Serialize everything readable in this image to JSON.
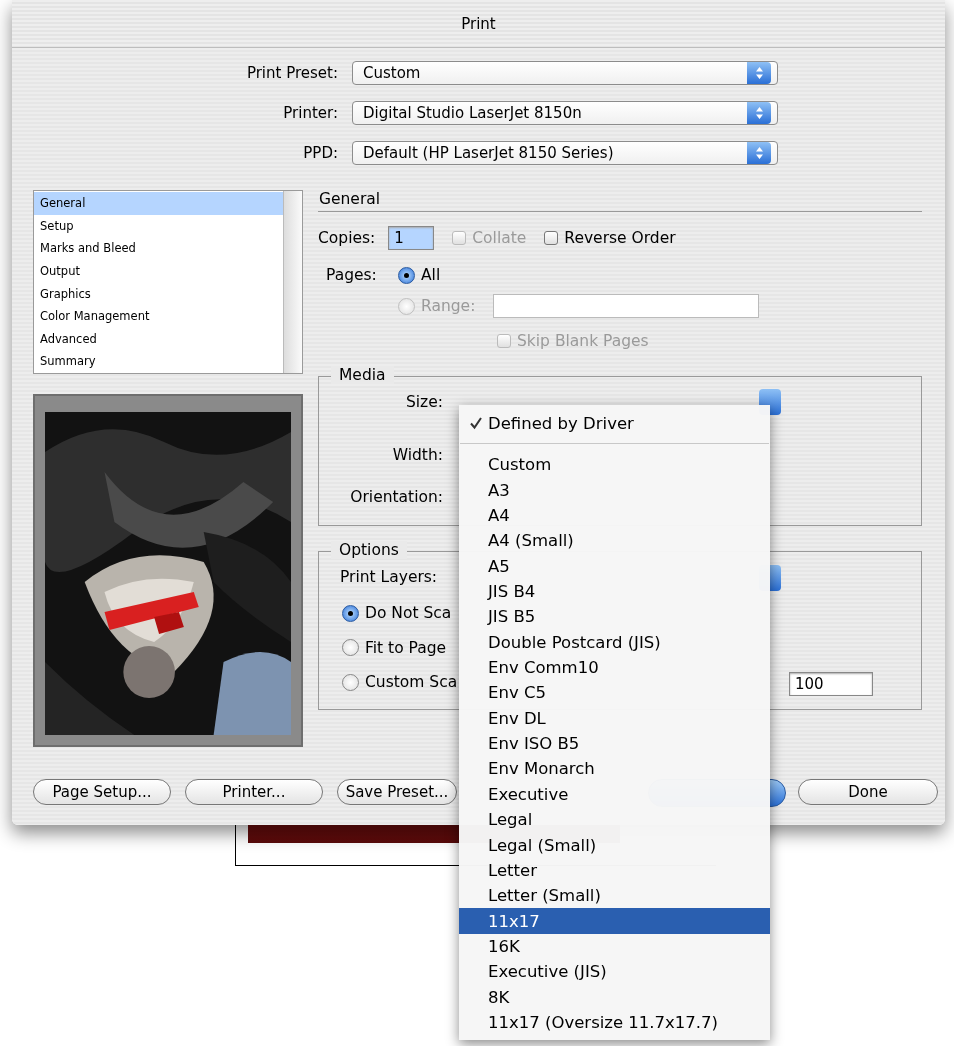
{
  "window": {
    "title": "Print"
  },
  "presets": [
    {
      "label": "Print Preset:",
      "value": "Custom"
    },
    {
      "label": "Printer:",
      "value": "Digital Studio LaserJet 8150n"
    },
    {
      "label": "PPD:",
      "value": "Default (HP LaserJet 8150 Series)"
    }
  ],
  "sidebar": {
    "items": [
      {
        "label": "General",
        "selected": true
      },
      {
        "label": "Setup",
        "selected": false
      },
      {
        "label": "Marks and Bleed",
        "selected": false
      },
      {
        "label": "Output",
        "selected": false
      },
      {
        "label": "Graphics",
        "selected": false
      },
      {
        "label": "Color Management",
        "selected": false
      },
      {
        "label": "Advanced",
        "selected": false
      },
      {
        "label": "Summary",
        "selected": false
      }
    ]
  },
  "general": {
    "heading": "General",
    "copies_label": "Copies:",
    "copies": "1",
    "collate": {
      "label": "Collate",
      "checked": false,
      "disabled": true
    },
    "reverse_order": {
      "label": "Reverse Order",
      "checked": false,
      "disabled": false
    },
    "pages_label": "Pages:",
    "pages_options": [
      {
        "label": "All",
        "selected": true,
        "disabled": false
      },
      {
        "label": "Range:",
        "selected": false,
        "disabled": true
      }
    ],
    "skip_blank": {
      "label": "Skip Blank Pages",
      "checked": false,
      "disabled": true
    }
  },
  "media": {
    "title": "Media",
    "size_label": "Size:",
    "width_label": "Width:",
    "orientation_label": "Orientation:"
  },
  "options": {
    "title": "Options",
    "print_layers_label": "Print Layers:",
    "scale_options": [
      {
        "label": "Do Not Sca",
        "selected": true
      },
      {
        "label": "Fit to Page",
        "selected": false
      },
      {
        "label": "Custom Sca",
        "selected": false
      }
    ],
    "height_value": "100"
  },
  "buttons": [
    {
      "label": "Page Setup..."
    },
    {
      "label": "Printer..."
    },
    {
      "label": "Save Preset..."
    }
  ],
  "done_button": {
    "label": "Done"
  },
  "size_menu": {
    "items": [
      {
        "label": "Defined by Driver",
        "checked": true,
        "selected": false
      },
      {
        "label": "Custom",
        "checked": false,
        "selected": false
      },
      {
        "label": "A3",
        "checked": false,
        "selected": false
      },
      {
        "label": "A4",
        "checked": false,
        "selected": false
      },
      {
        "label": "A4 (Small)",
        "checked": false,
        "selected": false
      },
      {
        "label": "A5",
        "checked": false,
        "selected": false
      },
      {
        "label": "JIS B4",
        "checked": false,
        "selected": false
      },
      {
        "label": "JIS B5",
        "checked": false,
        "selected": false
      },
      {
        "label": "Double Postcard (JIS)",
        "checked": false,
        "selected": false
      },
      {
        "label": "Env Comm10",
        "checked": false,
        "selected": false
      },
      {
        "label": "Env C5",
        "checked": false,
        "selected": false
      },
      {
        "label": "Env DL",
        "checked": false,
        "selected": false
      },
      {
        "label": "Env ISO B5",
        "checked": false,
        "selected": false
      },
      {
        "label": "Env Monarch",
        "checked": false,
        "selected": false
      },
      {
        "label": "Executive",
        "checked": false,
        "selected": false
      },
      {
        "label": "Legal",
        "checked": false,
        "selected": false
      },
      {
        "label": "Legal (Small)",
        "checked": false,
        "selected": false
      },
      {
        "label": "Letter",
        "checked": false,
        "selected": false
      },
      {
        "label": "Letter (Small)",
        "checked": false,
        "selected": false
      },
      {
        "label": "11x17",
        "checked": false,
        "selected": true
      },
      {
        "label": "16K",
        "checked": false,
        "selected": false
      },
      {
        "label": "Executive (JIS)",
        "checked": false,
        "selected": false
      },
      {
        "label": "8K",
        "checked": false,
        "selected": false
      },
      {
        "label": "11x17 (Oversize 11.7x17.7)",
        "checked": false,
        "selected": false
      }
    ]
  }
}
